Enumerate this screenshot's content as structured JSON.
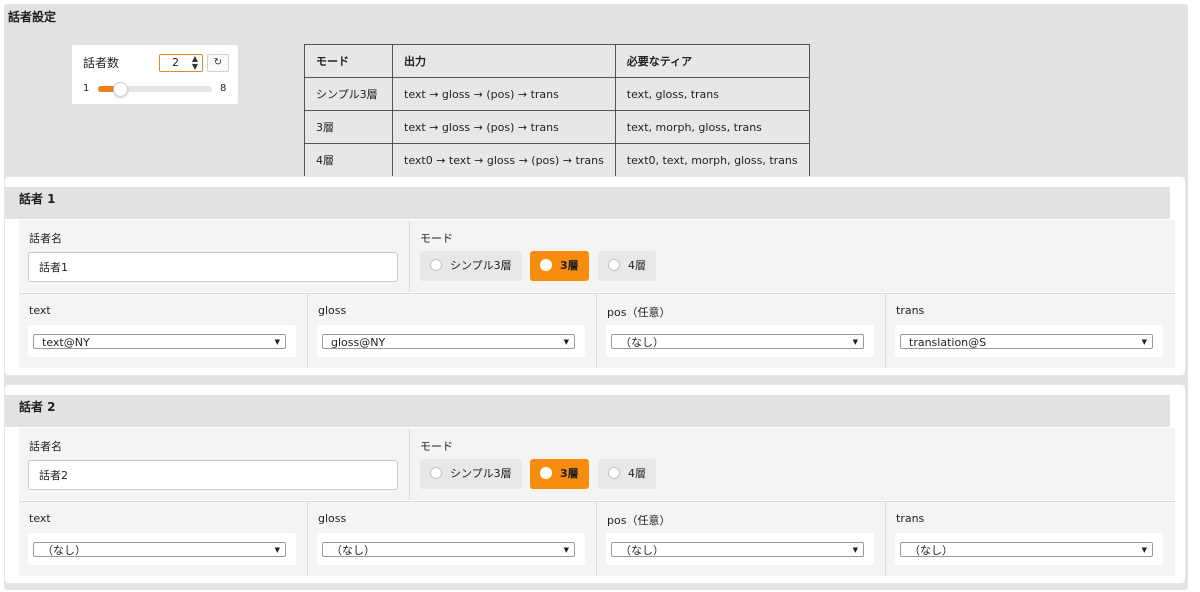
{
  "section_title": "話者設定",
  "speaker_count": {
    "label": "話者数",
    "value": "2",
    "min": "1",
    "max": "8",
    "slider_fraction": 0.143,
    "reset_icon": "refresh-icon"
  },
  "mode_table": {
    "headers": [
      "モード",
      "出力",
      "必要なティア"
    ],
    "rows": [
      [
        "シンプル3層",
        "text → gloss → (pos) → trans",
        "text, gloss, trans"
      ],
      [
        "3層",
        "text → gloss → (pos) → trans",
        "text, morph, gloss, trans"
      ],
      [
        "4層",
        "text0 → text → gloss → (pos) → trans",
        "text0, text, morph, gloss, trans"
      ]
    ]
  },
  "speakers": [
    {
      "title": "話者 1",
      "name_label": "話者名",
      "name_value": "話者1",
      "mode_label": "モード",
      "modes": [
        "シンプル3層",
        "3層",
        "4層"
      ],
      "selected_mode": 1,
      "tiers": [
        {
          "label": "text",
          "value": "text@NY"
        },
        {
          "label": "gloss",
          "value": "gloss@NY"
        },
        {
          "label": "pos（任意）",
          "value": "（なし）"
        },
        {
          "label": "trans",
          "value": "translation@S"
        }
      ]
    },
    {
      "title": "話者 2",
      "name_label": "話者名",
      "name_value": "話者2",
      "mode_label": "モード",
      "modes": [
        "シンプル3層",
        "3層",
        "4層"
      ],
      "selected_mode": 1,
      "tiers": [
        {
          "label": "text",
          "value": "（なし）"
        },
        {
          "label": "gloss",
          "value": "（なし）"
        },
        {
          "label": "pos（任意）",
          "value": "（なし）"
        },
        {
          "label": "trans",
          "value": "（なし）"
        }
      ]
    }
  ],
  "colors": {
    "accent": "#f88c0f",
    "panel_bg": "#e2e2e2",
    "field_bg": "#f4f4f4"
  }
}
